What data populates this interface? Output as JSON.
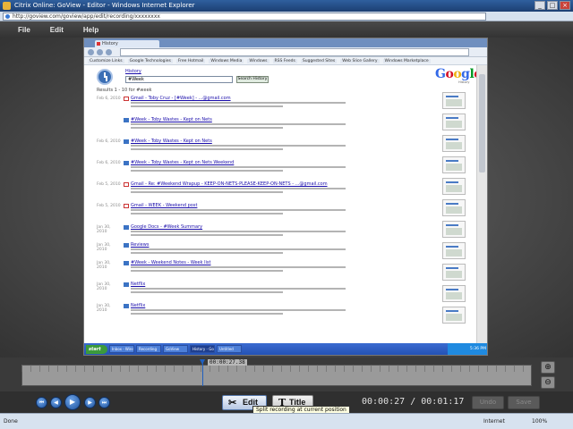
{
  "window": {
    "title": "Citrix Online: GoView - Editor - Windows Internet Explorer",
    "address": "http://goview.com/goview/app/edit/recording/xxxxxxxx"
  },
  "menu": {
    "items": [
      "File",
      "Edit",
      "Help"
    ]
  },
  "recorded": {
    "tab_label": "History",
    "bookmarks": [
      "Customize Links",
      "Google Technologies",
      "Free Hotmail",
      "Windows Media",
      "Windows",
      "RSS Feeds",
      "Suggested Sites",
      "Web Slice Gallery",
      "Windows Marketplace"
    ],
    "history_link": "History",
    "search_value": "#Week",
    "search_button": "Search History",
    "google_sub": "History",
    "results_head": "Results 1 - 10 for #week",
    "rows": [
      {
        "date": "Feb 6, 2010",
        "icon": "gmail",
        "title": "Gmail - Toby Cruz - [#Week] - ...@gmail.com"
      },
      {
        "date": "",
        "icon": "doc",
        "title": "#Week - Toby Wastes - Kept on Nets"
      },
      {
        "date": "Feb 6, 2010",
        "icon": "doc",
        "title": "#Week - Toby Wastes - Kept on Nets"
      },
      {
        "date": "Feb 6, 2010",
        "icon": "doc",
        "title": "#Week - Toby Wastes - Kept on Nets Weekend"
      },
      {
        "date": "Feb 5, 2010",
        "icon": "gmail",
        "title": "Gmail - Re: #Weekend Wrapup - KEEP-ON-NETS-PLEASE-KEEP-ON-NETS - ...@gmail.com"
      },
      {
        "date": "Feb 5, 2010",
        "icon": "gmail",
        "title": "Gmail - WEEK - Weekend post"
      },
      {
        "date": "Jan 30, 2010",
        "icon": "doc",
        "title": "Google Docs - #Week Summary"
      },
      {
        "date": "Jan 30, 2010",
        "icon": "doc",
        "title": "Reviews"
      },
      {
        "date": "Jan 30, 2010",
        "icon": "doc",
        "title": "#Week - Weekend Notes - Week list"
      },
      {
        "date": "Jan 30, 2010",
        "icon": "doc",
        "title": "Netflix"
      },
      {
        "date": "Jan 30, 2010",
        "icon": "doc",
        "title": "Netflix"
      }
    ],
    "taskbar": {
      "start": "start",
      "tasks": [
        "Inbox - Windo...",
        "Recording",
        "GoView",
        "History - Goo...",
        "Untitled"
      ],
      "clock": "5:36 PM"
    }
  },
  "timeline": {
    "playhead_time": "00:00:27.38"
  },
  "controls": {
    "edit_label": "Edit",
    "title_label": "Title",
    "current_time": "00:00:27",
    "separator": "/",
    "total_time": "00:01:17",
    "undo_label": "Undo",
    "save_label": "Save",
    "tooltip": "Split recording at current position"
  },
  "status": {
    "left": "Done",
    "zone": "Internet",
    "zoom": "100%"
  }
}
